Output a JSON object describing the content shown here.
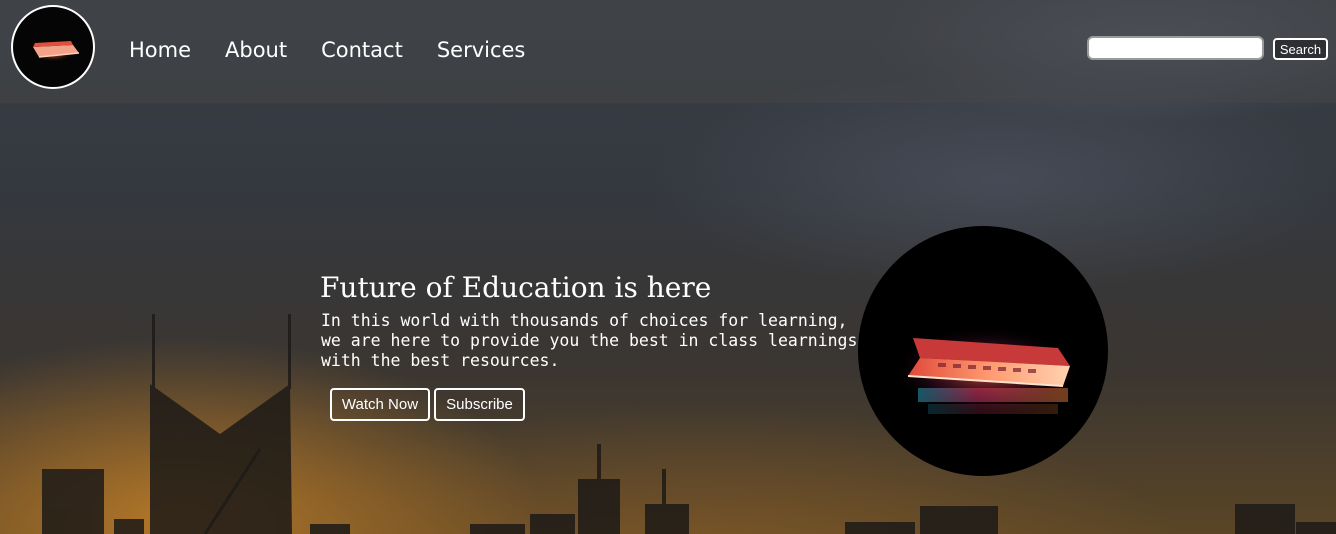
{
  "nav": {
    "logo_icon": "laptop-logo-icon",
    "links": [
      {
        "label": "Home"
      },
      {
        "label": "About"
      },
      {
        "label": "Contact"
      },
      {
        "label": "Services"
      }
    ],
    "search": {
      "placeholder": "",
      "value": "",
      "button_label": "Search"
    }
  },
  "hero": {
    "title": "Future of Education is here",
    "description": "In this world with thousands of choices for learning, we are here to provide you the best in class learnings with the best resources.",
    "buttons": {
      "watch_label": "Watch Now",
      "subscribe_label": "Subscribe"
    },
    "image_icon": "open-laptop-icon"
  },
  "colors": {
    "text": "#ffffff",
    "navbar_bg": "#464646",
    "image_bg": "#000000",
    "sky_glow": "#c48028"
  }
}
